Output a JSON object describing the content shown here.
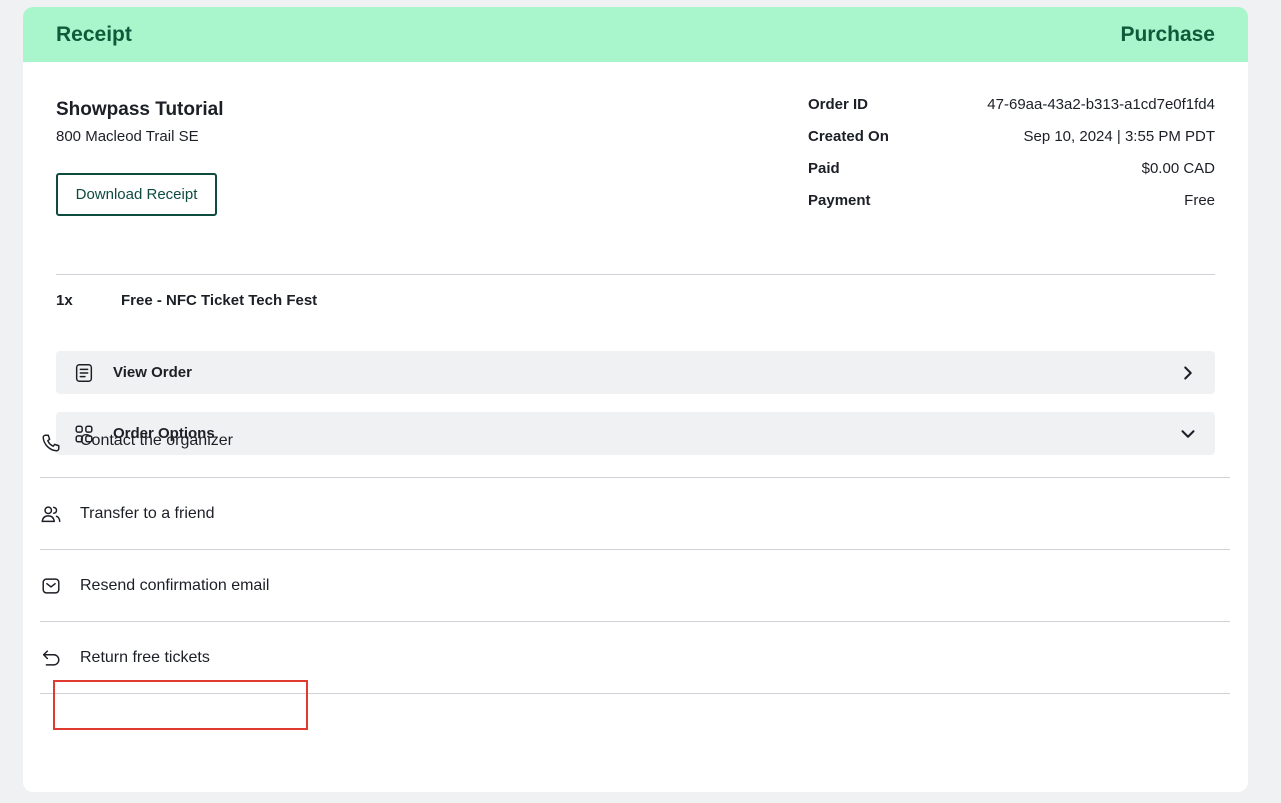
{
  "header": {
    "left_title": "Receipt",
    "right_title": "Purchase",
    "bg_color": "#a9f5cc",
    "text_color": "#0d5b3a"
  },
  "organizer": {
    "name": "Showpass Tutorial",
    "address": "800 Macleod Trail SE"
  },
  "download_button": {
    "label": "Download Receipt"
  },
  "order_meta": [
    {
      "key": "Order ID",
      "value": "47-69aa-43a2-b313-a1cd7e0f1fd4"
    },
    {
      "key": "Created On",
      "value": "Sep 10, 2024 | 3:55 PM PDT"
    },
    {
      "key": "Paid",
      "value": "$0.00 CAD"
    },
    {
      "key": "Payment",
      "value": "Free"
    }
  ],
  "line_item": {
    "quantity": "1x",
    "name": "Free - NFC Ticket Tech Fest"
  },
  "view_order": {
    "label": "View Order",
    "icon": "document-icon",
    "chevron": "chevron-right-icon"
  },
  "order_options": {
    "label": "Order Options",
    "icon": "grid-icon",
    "chevron": "chevron-down-icon",
    "items": [
      {
        "label": "Contact the organizer",
        "icon": "phone-icon"
      },
      {
        "label": "Transfer to a friend",
        "icon": "users-icon"
      },
      {
        "label": "Resend confirmation email",
        "icon": "mail-icon"
      },
      {
        "label": "Return free tickets",
        "icon": "return-arrow-icon"
      }
    ]
  },
  "highlight_color": "#e03a31"
}
